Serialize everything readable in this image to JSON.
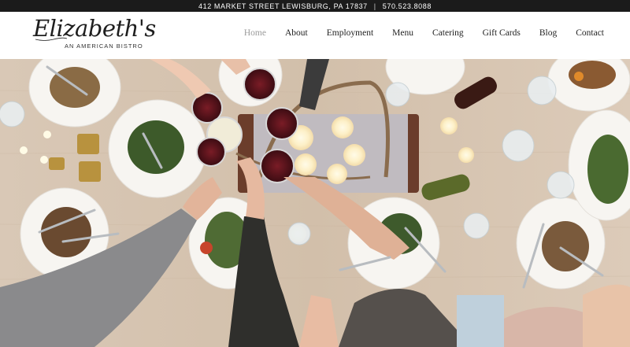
{
  "topbar": {
    "address": "412 MARKET STREET LEWISBURG, PA 17837",
    "separator": "|",
    "phone": "570.523.8088"
  },
  "logo": {
    "name": "Elizabeth's",
    "tagline": "AN AMERICAN BISTRO"
  },
  "nav": {
    "items": [
      {
        "label": "Home",
        "active": true
      },
      {
        "label": "About",
        "active": false
      },
      {
        "label": "Employment",
        "active": false
      },
      {
        "label": "Menu",
        "active": false
      },
      {
        "label": "Catering",
        "active": false
      },
      {
        "label": "Gift Cards",
        "active": false
      },
      {
        "label": "Blog",
        "active": false
      },
      {
        "label": "Contact",
        "active": false
      }
    ]
  },
  "colors": {
    "topbar_bg": "#1b1b1b",
    "nav_active": "#9a9a9a",
    "table_wood": "#d7c5b2"
  }
}
